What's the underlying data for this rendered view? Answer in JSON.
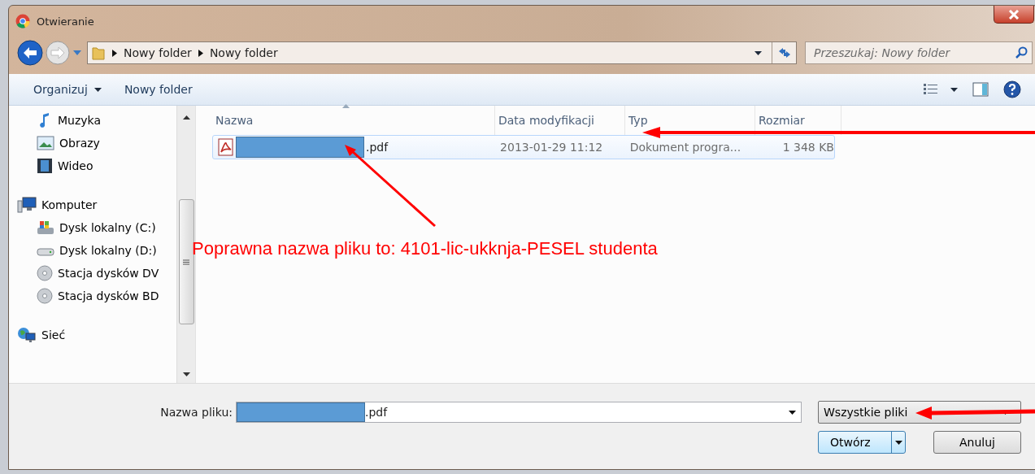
{
  "window": {
    "title": "Otwieranie"
  },
  "address": {
    "path": [
      "Nowy folder",
      "Nowy folder"
    ],
    "search_placeholder": "Przeszukaj: Nowy folder"
  },
  "toolbar": [
    {
      "label": "Organizuj",
      "kind": "menu"
    },
    {
      "label": "Nowy folder",
      "kind": "plain"
    }
  ],
  "sidebar": {
    "sections": [
      {
        "items": [
          {
            "label": "Muzyka"
          },
          {
            "label": "Obrazy"
          },
          {
            "label": "Wideo"
          }
        ]
      },
      {
        "items": [
          {
            "label": "Komputer",
            "children": [
              {
                "label": "Dysk lokalny (C:)"
              },
              {
                "label": "Dysk lokalny (D:)"
              },
              {
                "label": "Stacja dysków DV"
              },
              {
                "label": "Stacja dysków BD"
              }
            ]
          }
        ]
      },
      {
        "items": [
          {
            "label": "Sieć"
          }
        ]
      }
    ]
  },
  "table": {
    "columns": [
      "Nazwa",
      "Data modyfikacji",
      "Typ",
      "Rozmiar"
    ],
    "rows": [
      {
        "name": ".pdf",
        "redacted": true,
        "date": "2013-01-29 11:12",
        "type": "Dokument progra...",
        "size": "1 348 KB",
        "selected": true
      }
    ]
  },
  "footer": {
    "filename_label": "Nazwa pliku:",
    "filename": ".pdf",
    "filename_redacted": true,
    "filter": "Wszystkie pliki",
    "open": "Otwórz",
    "cancel": "Anuluj"
  },
  "annotation": {
    "text": "Poprawna nazwa pliku to: 4101-lic-ukknja-PESEL studenta"
  }
}
